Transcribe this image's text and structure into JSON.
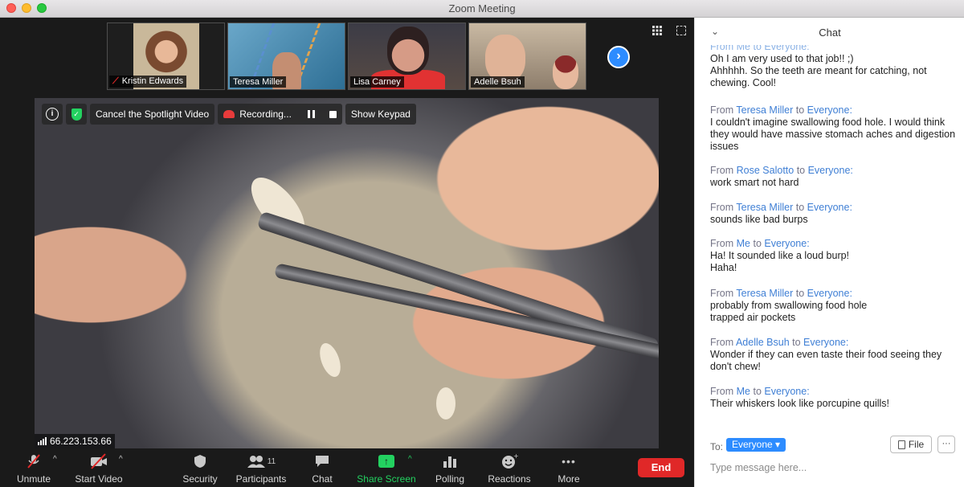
{
  "window": {
    "title": "Zoom Meeting"
  },
  "participants_strip": [
    {
      "name": "Kristin Edwards",
      "muted": true
    },
    {
      "name": "Teresa Miller",
      "muted": false
    },
    {
      "name": "Lisa Carney",
      "muted": false
    },
    {
      "name": "Adelle Bsuh",
      "muted": false
    }
  ],
  "spotlight_controls": {
    "cancel_spotlight": "Cancel the Spotlight Video",
    "recording": "Recording...",
    "show_keypad": "Show Keypad"
  },
  "connection": {
    "ip": "66.223.153.66"
  },
  "toolbar": {
    "unmute": "Unmute",
    "start_video": "Start Video",
    "security": "Security",
    "participants": "Participants",
    "participants_count": "11",
    "chat": "Chat",
    "share_screen": "Share Screen",
    "polling": "Polling",
    "reactions": "Reactions",
    "more": "More",
    "end": "End"
  },
  "chat": {
    "title": "Chat",
    "partial_top_header": "From Me to Everyone:",
    "partial_top_lines": [
      "Oh I am very used to that job!! ;)",
      "Ahhhhh. So the teeth are meant for catching, not chewing. Cool!"
    ],
    "messages": [
      {
        "from_prefix": "From ",
        "sender": "Teresa Miller",
        "to": " to ",
        "recipient": "Everyone:",
        "text": "I couldn't imagine swallowing food hole. I would think they would have massive stomach aches and digestion issues"
      },
      {
        "from_prefix": "From ",
        "sender": "Rose Salotto",
        "to": " to ",
        "recipient": "Everyone:",
        "text": "work smart not hard"
      },
      {
        "from_prefix": "From ",
        "sender": "Teresa Miller",
        "to": " to ",
        "recipient": "Everyone:",
        "text": "sounds like bad burps"
      },
      {
        "from_prefix": "From ",
        "sender": "Me",
        "to": " to ",
        "recipient": "Everyone:",
        "text": "Ha! It sounded like a loud burp!\nHaha!"
      },
      {
        "from_prefix": "From ",
        "sender": "Teresa Miller",
        "to": " to ",
        "recipient": "Everyone:",
        "text": "probably from swallowing food hole\ntrapped air pockets"
      },
      {
        "from_prefix": "From ",
        "sender": "Adelle Bsuh",
        "to": " to ",
        "recipient": "Everyone:",
        "text": "Wonder if they can even taste their food seeing they don't chew!"
      },
      {
        "from_prefix": "From ",
        "sender": "Me",
        "to": " to ",
        "recipient": "Everyone:",
        "text": "Their whiskers look like porcupine quills!"
      }
    ],
    "to_label": "To:",
    "to_value": "Everyone ▾",
    "file_label": "File",
    "more_label": "···",
    "input_placeholder": "Type message here..."
  },
  "colors": {
    "accent": "#2d8cff",
    "end": "#e02828",
    "share": "#23d160",
    "sender": "#3f7fd5"
  }
}
